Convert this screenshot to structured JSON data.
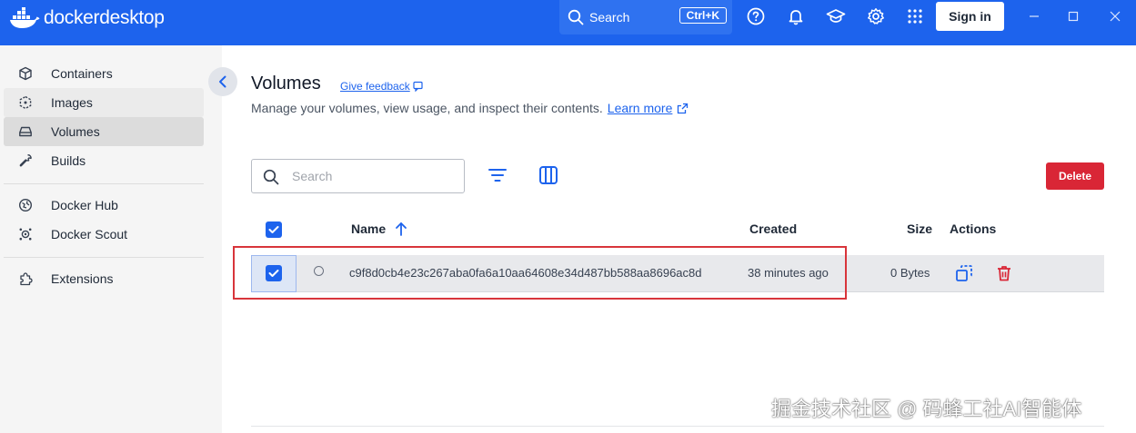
{
  "app": {
    "brand_docker": "docker",
    "brand_desktop": "desktop"
  },
  "topbar": {
    "search_label": "Search",
    "search_shortcut": "Ctrl+K",
    "sign_in": "Sign in"
  },
  "sidebar": {
    "items": [
      {
        "label": "Containers",
        "icon": "container-icon"
      },
      {
        "label": "Images",
        "icon": "image-icon"
      },
      {
        "label": "Volumes",
        "icon": "volume-icon"
      },
      {
        "label": "Builds",
        "icon": "wrench-icon"
      },
      {
        "label": "Docker Hub",
        "icon": "hub-icon"
      },
      {
        "label": "Docker Scout",
        "icon": "scout-icon"
      },
      {
        "label": "Extensions",
        "icon": "puzzle-icon"
      }
    ],
    "active": "Volumes"
  },
  "page": {
    "title": "Volumes",
    "feedback": "Give feedback",
    "subtitle": "Manage your volumes, view usage, and inspect their contents.",
    "learn_more": "Learn more"
  },
  "toolbar": {
    "search_placeholder": "Search",
    "delete_label": "Delete"
  },
  "table": {
    "columns": {
      "name": "Name",
      "created": "Created",
      "size": "Size",
      "actions": "Actions"
    },
    "rows": [
      {
        "name": "c9f8d0cb4e23c267aba0fa6a10aa64608e34d487bb588aa8696ac8d",
        "created": "38 minutes ago",
        "size": "0 Bytes",
        "selected": true
      }
    ]
  },
  "watermark": "掘金技术社区 @ 码蜂工社AI智能体",
  "colors": {
    "brand": "#1d63ed",
    "danger": "#d92636",
    "highlight": "#d8353b"
  }
}
